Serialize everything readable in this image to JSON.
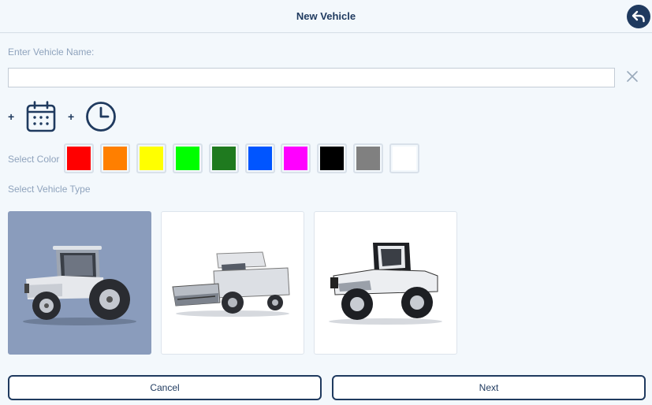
{
  "header": {
    "title": "New Vehicle",
    "back_icon": "undo-arrow-icon"
  },
  "form": {
    "name_label": "Enter Vehicle Name:",
    "name_value": "",
    "name_placeholder": "",
    "plus1": "+",
    "plus2": "+",
    "color_label": "Select Color",
    "type_label": "Select Vehicle Type"
  },
  "colors": [
    "#ff0000",
    "#ff7f00",
    "#ffff00",
    "#00ff00",
    "#1f7a1f",
    "#0055ff",
    "#ff00ff",
    "#000000",
    "#808080",
    "#ffffff"
  ],
  "vehicle_types": [
    {
      "name": "tractor",
      "selected": true
    },
    {
      "name": "combine-harvester",
      "selected": false
    },
    {
      "name": "articulated-tractor",
      "selected": false
    }
  ],
  "buttons": {
    "cancel": "Cancel",
    "next": "Next"
  },
  "theme": {
    "accent": "#1f3a5f",
    "selected_bg": "#8a9cbc"
  }
}
